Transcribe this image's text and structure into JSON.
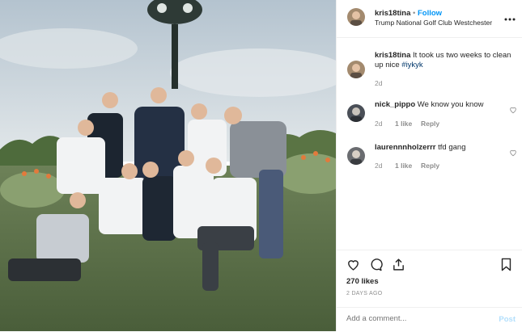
{
  "post": {
    "username": "kris18tina",
    "separator": "•",
    "follow_label": "Follow",
    "location": "Trump National Golf Club Westchester",
    "more_icon": "more-horizontal-icon"
  },
  "caption": {
    "username": "kris18tina",
    "text": "It took us two weeks to clean up nice",
    "hashtag": "#iykyk",
    "time": "2d"
  },
  "comments": [
    {
      "username": "nick_pippo",
      "text": "We know you know",
      "time": "2d",
      "likes": "1 like",
      "reply": "Reply"
    },
    {
      "username": "laurennnholzerrr",
      "text": "tfd gang",
      "time": "2d",
      "likes": "1 like",
      "reply": "Reply"
    }
  ],
  "actions": {
    "likes": "270 likes",
    "date": "2 DAYS AGO",
    "icons": [
      "heart-icon",
      "comment-icon",
      "share-icon",
      "bookmark-icon"
    ]
  },
  "comment_box": {
    "placeholder": "Add a comment...",
    "post_label": "Post"
  },
  "colors": {
    "accent": "#0095f6",
    "text": "#262626",
    "muted": "#8e8e8e"
  }
}
